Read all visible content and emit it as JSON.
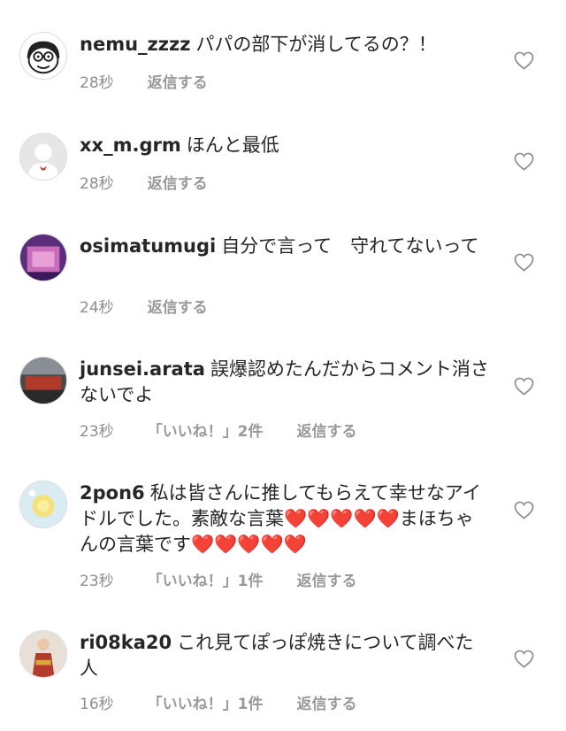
{
  "comments": [
    {
      "username": "nemu_zzzz",
      "text": "パパの部下が消してるの？！",
      "time": "28秒",
      "likes": "",
      "reply": "返信する"
    },
    {
      "username": "xx_m.grm",
      "text": "ほんと最低",
      "time": "28秒",
      "likes": "",
      "reply": "返信する"
    },
    {
      "username": "osimatumugi",
      "text": "自分で言って　守れてないって",
      "time": "24秒",
      "likes": "",
      "reply": "返信する"
    },
    {
      "username": "junsei.arata",
      "text": "誤爆認めたんだからコメント消さないでよ",
      "time": "23秒",
      "likes": "「いいね！」2件",
      "reply": "返信する"
    },
    {
      "username": "2pon6",
      "text": "私は皆さんに推してもらえて幸せなアイドルでした。素敵な言葉❤️❤️❤️❤️❤️まほちゃんの言葉です❤️❤️❤️❤️❤️",
      "time": "23秒",
      "likes": "「いいね！」1件",
      "reply": "返信する"
    },
    {
      "username": "ri08ka20",
      "text": "これ見てぽっぽ焼きについて調べた人",
      "time": "16秒",
      "likes": "「いいね！」1件",
      "reply": "返信する"
    }
  ],
  "icons": {
    "like": "heart-outline-icon"
  },
  "colors": {
    "text": "#262626",
    "meta": "#8e8e8e",
    "heart_emoji": "#e52e3d"
  }
}
